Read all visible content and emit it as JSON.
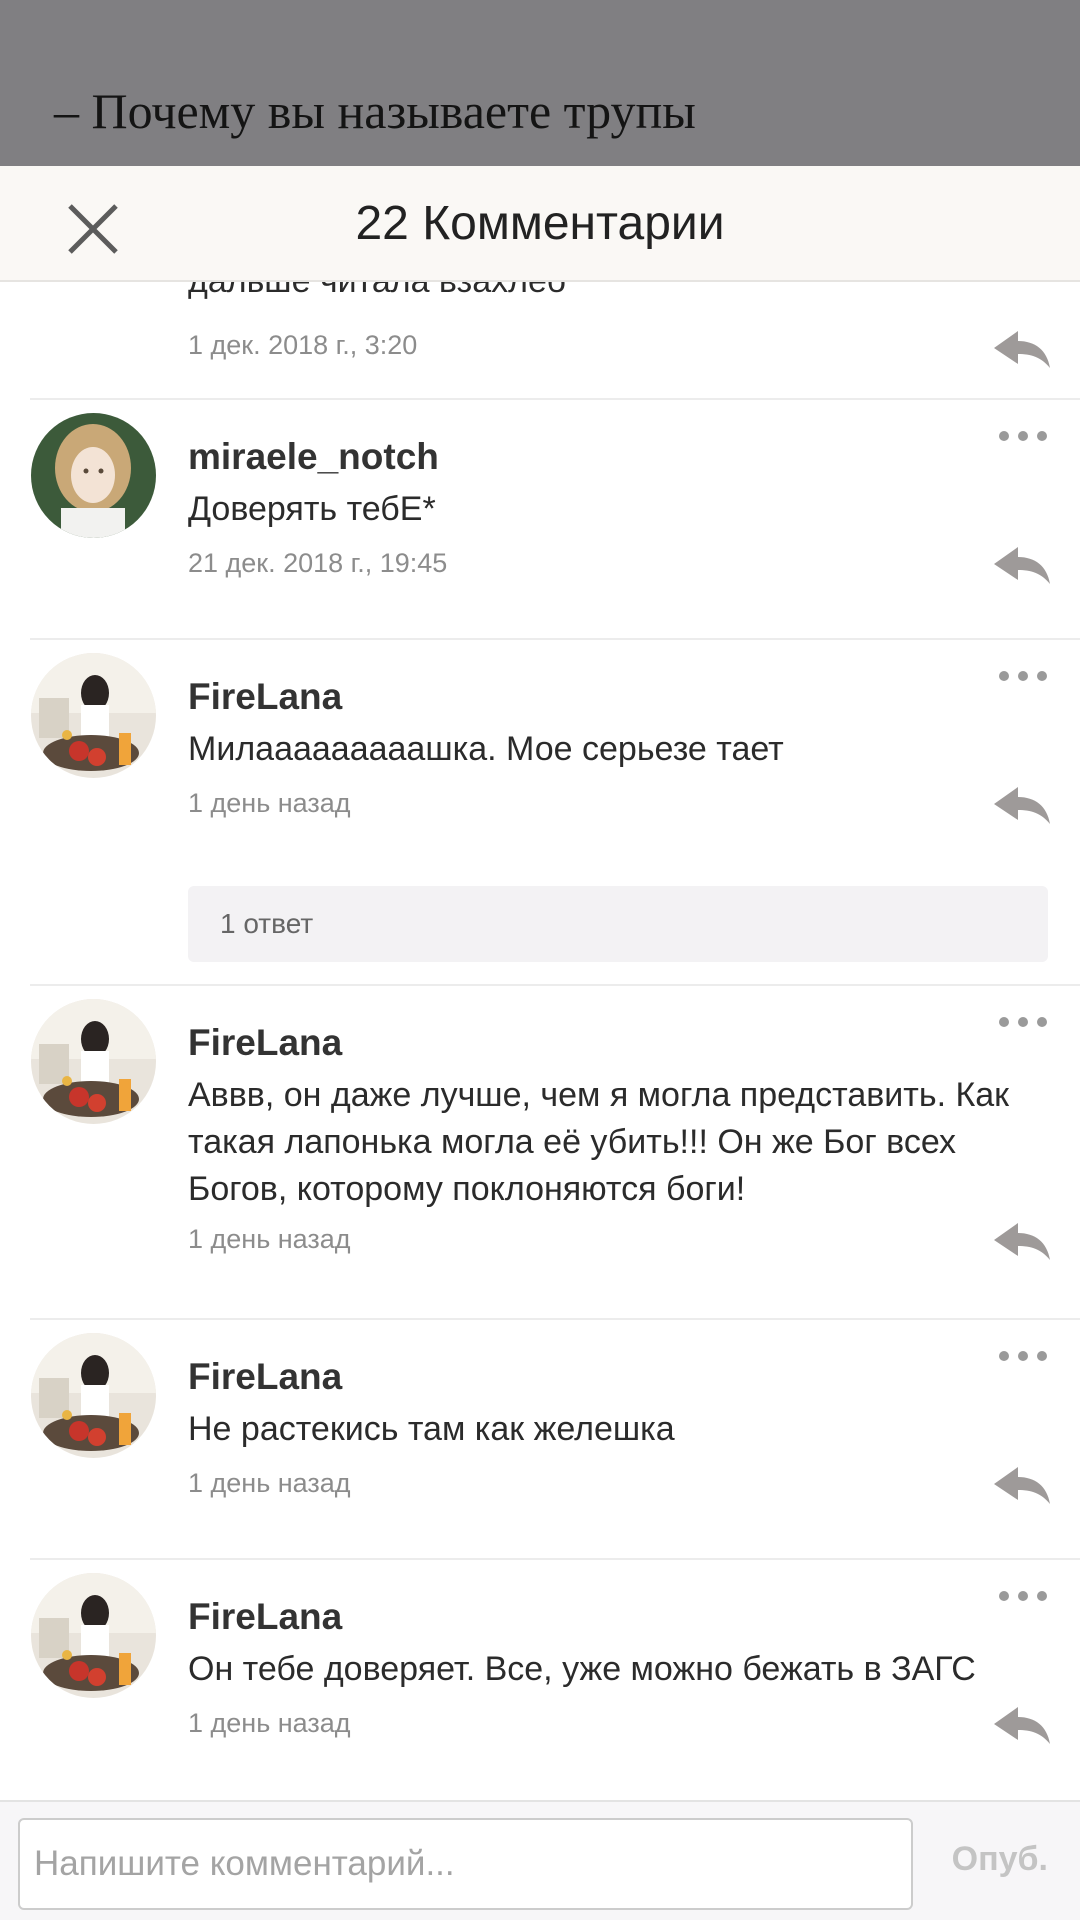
{
  "story": {
    "title": "– Почему вы называете трупы"
  },
  "header": {
    "title": "22 Комментарии"
  },
  "previous_comment": {
    "text": "дальше читала взахлеб",
    "time": "1 дек. 2018 г., 3:20"
  },
  "comments": [
    {
      "author": "miraele_notch",
      "text": "Доверять тебЕ*",
      "time": "21 дек. 2018 г., 19:45"
    },
    {
      "author": "FireLana",
      "text": "Милааааааааашка. Мое серьезе тает",
      "time": "1 день назад",
      "replies": "1 ответ"
    },
    {
      "author": "FireLana",
      "text": "Аввв, он даже лучше, чем я могла представить. Как такая лапонька могла её убить!!! Он же Бог всех Богов, которому поклоняются боги!",
      "time": "1 день назад"
    },
    {
      "author": "FireLana",
      "text": "Не растекись там как желешка",
      "time": "1 день назад"
    },
    {
      "author": "FireLana",
      "text": "Он тебе доверяет. Все, уже можно бежать в ЗАГС",
      "time": "1 день назад"
    }
  ],
  "composer": {
    "placeholder": "Напишите комментарий...",
    "publish_label": "Опуб."
  },
  "icons": {
    "close": "close-icon",
    "reply": "reply-arrow-icon",
    "more": "more-dots-icon",
    "avatar": "avatar-photo"
  },
  "colors": {
    "story_header_bg": "#807f82",
    "modal_header_bg": "#faf8f5",
    "muted_text": "#8c8c8c",
    "icon_gray": "#9e9a99"
  }
}
